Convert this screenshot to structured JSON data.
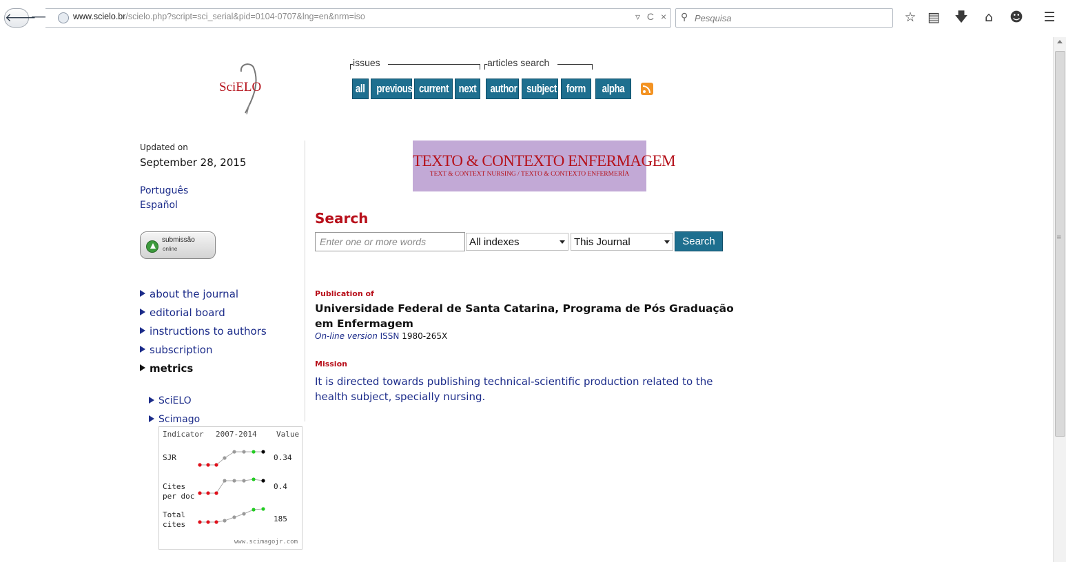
{
  "browser": {
    "url_domain": "www.scielo.br",
    "url_path": "/scielo.php?script=sci_serial&pid=0104-0707&lng=en&nrm=iso",
    "search_placeholder": "Pesquisa",
    "url_actions": [
      "▿",
      "C",
      "×"
    ]
  },
  "header": {
    "logo_text": "SciELO",
    "issues_label": "issues",
    "articles_label": "articles search",
    "issue_buttons": [
      "all",
      "previous",
      "current",
      "next"
    ],
    "search_buttons": [
      "author",
      "subject",
      "form"
    ],
    "alpha_button": "alpha"
  },
  "sidebar": {
    "updated_label": "Updated on",
    "updated_date": "September 28, 2015",
    "languages": [
      "Português",
      "Español"
    ],
    "submit_line1": "submissão",
    "submit_line2": "online",
    "menu": [
      "about the journal",
      "editorial board",
      "instructions to authors",
      "subscription",
      "metrics"
    ],
    "metrics_sub": [
      "SciELO",
      "Scimago"
    ]
  },
  "scimago": {
    "headers": [
      "Indicator",
      "2007-2014",
      "Value"
    ],
    "rows": [
      {
        "label": "SJR",
        "value": "0.34"
      },
      {
        "label": "Cites\nper doc",
        "value": "0.4"
      },
      {
        "label": "Total\ncites",
        "value": "185"
      }
    ],
    "footer": "www.scimagojr.com",
    "colors": {
      "low": "#e0101b",
      "mid": "#9a9a9a",
      "high": "#22cc22",
      "last": "#000000"
    }
  },
  "main": {
    "banner_title": "TEXTO & CONTEXTO ENFERMAGEM",
    "banner_subtitle": "TEXT & CONTEXT NURSING / TEXTO & CONTEXTO ENFERMERÍA",
    "search_title": "Search",
    "search_placeholder": "Enter one or more words",
    "index_select": "All indexes",
    "scope_select": "This Journal",
    "search_button": "Search",
    "publication_label": "Publication of",
    "publisher": "Universidade Federal de Santa Catarina, Programa de Pós Graduação em Enfermagem",
    "online_version": "On-line version",
    "issn_label": "ISSN",
    "issn_value": "1980-265X",
    "mission_label": "Mission",
    "mission_text": "It is directed towards publishing technical-scientific production related to the health subject, specially nursing."
  },
  "theme": {
    "accent": "#1e6f8f",
    "brand_red": "#b8101b",
    "link": "#1c2c8a"
  }
}
